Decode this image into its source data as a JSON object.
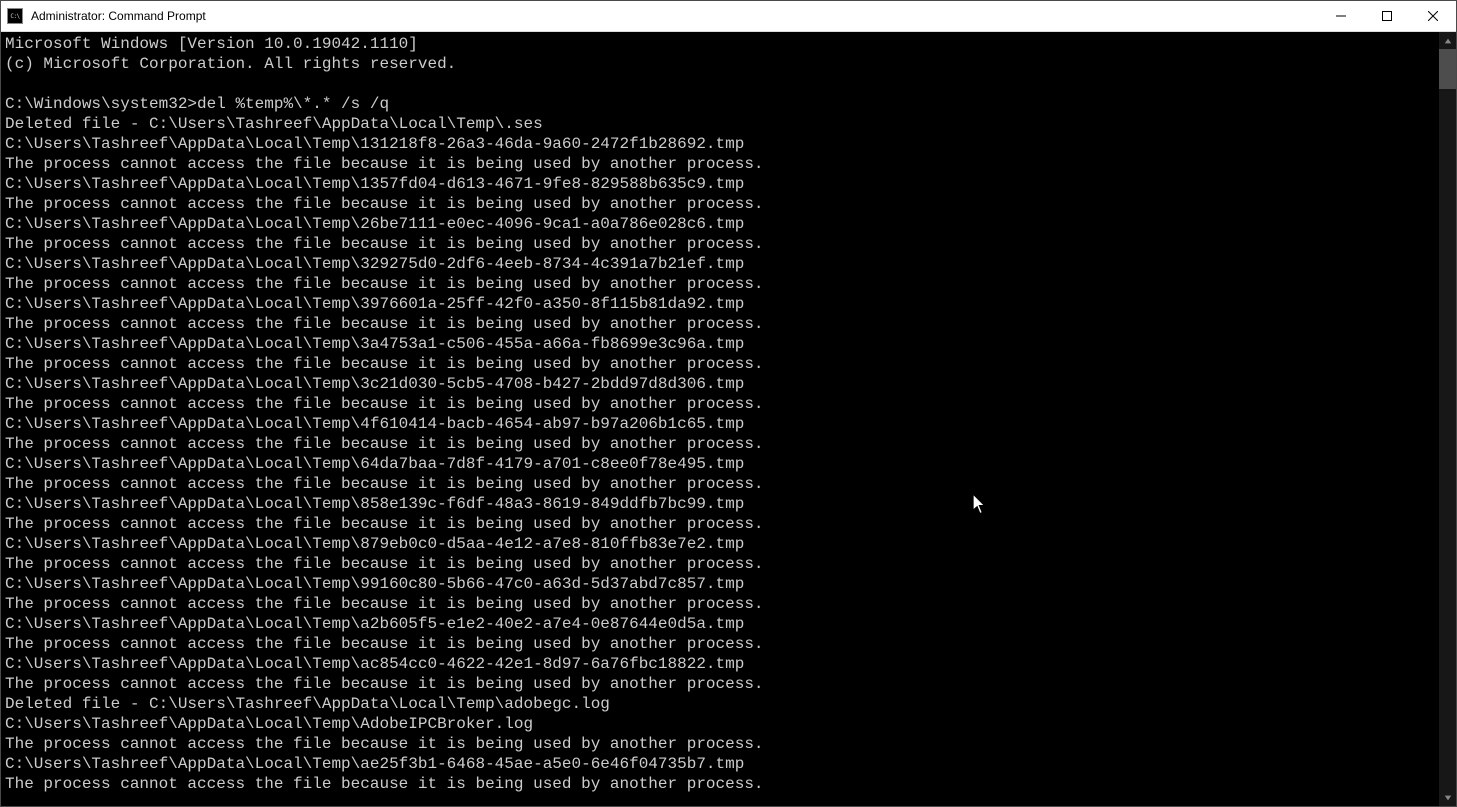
{
  "window": {
    "title": "Administrator: Command Prompt"
  },
  "console": {
    "header": [
      "Microsoft Windows [Version 10.0.19042.1110]",
      "(c) Microsoft Corporation. All rights reserved.",
      ""
    ],
    "prompt": "C:\\Windows\\system32>",
    "command": "del %temp%\\*.* /s /q",
    "deleted_prefix": "Deleted file - ",
    "temp_path": "C:\\Users\\Tashreef\\AppData\\Local\\Temp\\",
    "access_error": "The process cannot access the file because it is being used by another process.",
    "first_deleted": ".ses",
    "locked_files": [
      "131218f8-26a3-46da-9a60-2472f1b28692.tmp",
      "1357fd04-d613-4671-9fe8-829588b635c9.tmp",
      "26be7111-e0ec-4096-9ca1-a0a786e028c6.tmp",
      "329275d0-2df6-4eeb-8734-4c391a7b21ef.tmp",
      "3976601a-25ff-42f0-a350-8f115b81da92.tmp",
      "3a4753a1-c506-455a-a66a-fb8699e3c96a.tmp",
      "3c21d030-5cb5-4708-b427-2bdd97d8d306.tmp",
      "4f610414-bacb-4654-ab97-b97a206b1c65.tmp",
      "64da7baa-7d8f-4179-a701-c8ee0f78e495.tmp",
      "858e139c-f6df-48a3-8619-849ddfb7bc99.tmp",
      "879eb0c0-d5aa-4e12-a7e8-810ffb83e7e2.tmp",
      "99160c80-5b66-47c0-a63d-5d37abd7c857.tmp",
      "a2b605f5-e1e2-40e2-a7e4-0e87644e0d5a.tmp",
      "ac854cc0-4622-42e1-8d97-6a76fbc18822.tmp"
    ],
    "second_deleted": "adobegc.log",
    "locked_files_tail": [
      "AdobeIPCBroker.log",
      "ae25f3b1-6468-45ae-a5e0-6e46f04735b7.tmp"
    ]
  }
}
